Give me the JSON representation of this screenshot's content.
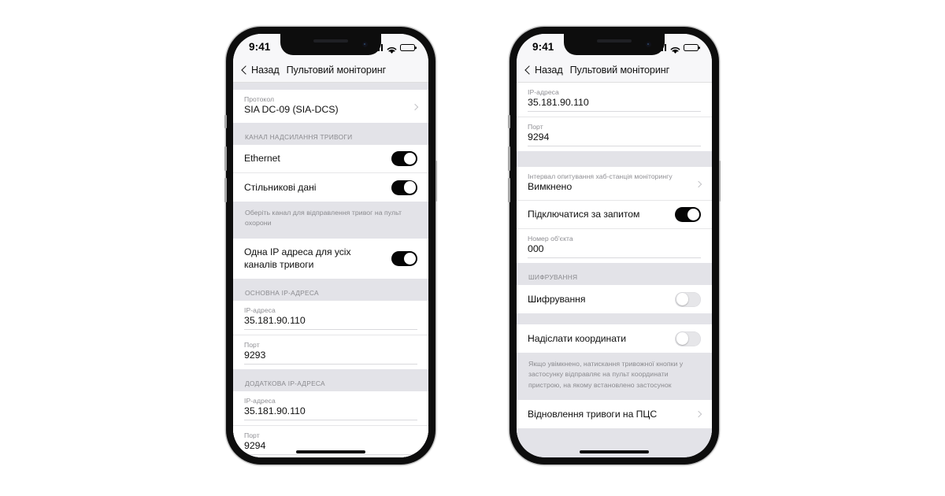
{
  "left_phone": {
    "statusbar": {
      "time": "9:41",
      "signal_icon": "cellular-bars-icon",
      "wifi_icon": "wifi-icon",
      "battery_icon": "battery-full-icon"
    },
    "nav": {
      "back_label": "Назад",
      "title": "Пультовий моніторинг",
      "back_icon": "chevron-left-icon"
    },
    "rows": [
      {
        "kind": "value-chevron",
        "caption": "Протокол",
        "value": "SIA DC-09 (SIA-DCS)",
        "chevron": "chevron-right-icon"
      },
      {
        "kind": "section",
        "title": "КАНАЛ НАДСИЛАННЯ ТРИВОГИ"
      },
      {
        "kind": "toggle",
        "label": "Ethernet",
        "state": "on"
      },
      {
        "kind": "toggle",
        "label": "Стільникові дані",
        "state": "on"
      },
      {
        "kind": "footnote",
        "text": "Оберіть канал для відправлення тривог на пульт охорони"
      },
      {
        "kind": "toggle",
        "label": "Одна IP адреса для усіх каналів тривоги",
        "state": "on"
      },
      {
        "kind": "section",
        "title": "ОСНОВНА IP-АДРЕСА"
      },
      {
        "kind": "field",
        "caption": "IP-адреса",
        "value": "35.181.90.110"
      },
      {
        "kind": "field",
        "caption": "Порт",
        "value": "9293"
      },
      {
        "kind": "section",
        "title": "ДОДАТКОВА IP-АДРЕСА"
      },
      {
        "kind": "field",
        "caption": "IP-адреса",
        "value": "35.181.90.110"
      },
      {
        "kind": "field",
        "caption": "Порт",
        "value": "9294"
      }
    ]
  },
  "right_phone": {
    "statusbar": {
      "time": "9:41",
      "signal_icon": "cellular-bars-icon",
      "wifi_icon": "wifi-icon",
      "battery_icon": "battery-full-icon"
    },
    "nav": {
      "back_label": "Назад",
      "title": "Пультовий моніторинг",
      "back_icon": "chevron-left-icon"
    },
    "rows": [
      {
        "kind": "field",
        "caption": "IP-адреса",
        "value": "35.181.90.110"
      },
      {
        "kind": "field",
        "caption": "Порт",
        "value": "9294"
      },
      {
        "kind": "value-chevron",
        "caption": "Інтервал опитування хаб-станція моніторингу",
        "value": "Вимкнено",
        "chevron": "chevron-right-icon"
      },
      {
        "kind": "toggle",
        "label": "Підключатися за запитом",
        "state": "on"
      },
      {
        "kind": "field",
        "caption": "Номер об'єкта",
        "value": "000"
      },
      {
        "kind": "section",
        "title": "ШИФРУВАННЯ"
      },
      {
        "kind": "toggle",
        "label": "Шифрування",
        "state": "off"
      },
      {
        "kind": "toggle",
        "label": "Надіслати координати",
        "state": "off"
      },
      {
        "kind": "footnote",
        "text": "Якщо увімкнено, натискання тривожної кнопки у застосунку відправляє на пульт координати пристрою, на якому встановлено застосунок"
      },
      {
        "kind": "link",
        "label": "Відновлення тривоги на ПЦС",
        "chevron": "chevron-right-icon"
      }
    ]
  },
  "colors": {
    "toggle_on": "#050505",
    "toggle_off": "#e6e6e9",
    "list_bg": "#e3e3e8",
    "row_bg": "#ffffff",
    "caption": "#8e8e93",
    "chrome": "#f7f7f9"
  }
}
